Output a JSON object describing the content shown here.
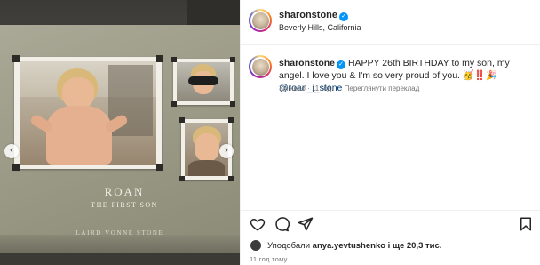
{
  "post": {
    "slide_count": 3,
    "current_slide": 2
  },
  "photo": {
    "book_title": "ROAN",
    "book_subtitle": "THE FIRST SON",
    "spine_text": "LAIRD VONNE STONE",
    "prev_glyph": "‹",
    "next_glyph": "›"
  },
  "header": {
    "username": "sharonstone",
    "verified_glyph": "✓",
    "location": "Beverly Hills, California"
  },
  "caption": {
    "username": "sharonstone",
    "verified_glyph": "✓",
    "text": "HAPPY 26th BIRTHDAY to my son, my angel.  I love you & I'm so very proud of you. 🥳‼️🎉 ",
    "mention": "@roan_j_stone",
    "edited_label": "Змінено",
    "separator": " · ",
    "time": "11 год.",
    "translate_label": "Переглянути переклад"
  },
  "actions": {
    "icons": [
      "heart-icon",
      "comment-icon",
      "share-icon",
      "bookmark-icon"
    ]
  },
  "likes": {
    "prefix": "Уподобали ",
    "user": "anya.yevtushenko",
    "suffix": " і ще 20,3 тис."
  },
  "timestamp": "11 год тому",
  "colors": {
    "verified": "#0095f6",
    "link": "#00376b",
    "secondary_text": "#737373"
  }
}
